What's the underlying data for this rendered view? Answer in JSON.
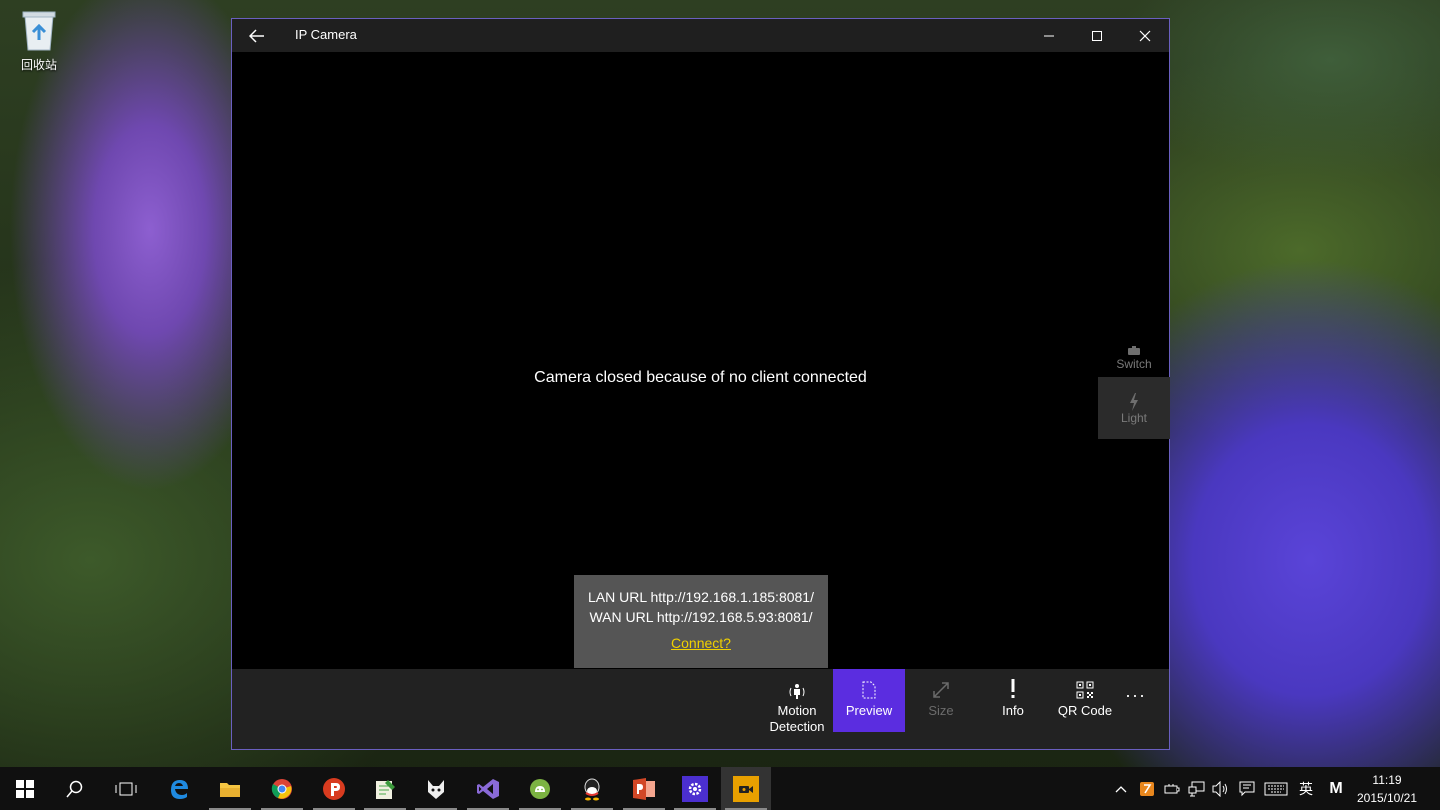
{
  "desktop": {
    "recycle_bin_label": "回收站"
  },
  "window": {
    "title": "IP Camera",
    "status_message": "Camera closed because of no client connected",
    "side_buttons": {
      "switch_label": "Switch",
      "light_label": "Light"
    },
    "url_popup": {
      "lan_url": "LAN URL http://192.168.1.185:8081/",
      "wan_url": "WAN URL http://192.168.5.93:8081/",
      "connect_link": "Connect?"
    },
    "app_bar": {
      "motion_detection_label_1": "Motion",
      "motion_detection_label_2": "Detection",
      "preview_label": "Preview",
      "size_label": "Size",
      "info_label": "Info",
      "qr_code_label": "QR Code",
      "more_label": "···"
    },
    "accent_color": "#5b2de0"
  },
  "taskbar": {
    "pinned_icons": [
      "start-icon",
      "search-icon",
      "task-view-icon",
      "edge-icon",
      "file-explorer-icon",
      "chrome-icon",
      "p-app-icon",
      "notepad-app-icon",
      "foobar-icon",
      "visual-studio-icon",
      "android-studio-icon",
      "qq-icon",
      "powerpoint-icon",
      "settings-icon",
      "ip-camera-icon"
    ],
    "tray": {
      "ime_label": "英",
      "m_label": "M",
      "time": "11:19",
      "date": "2015/10/21"
    }
  }
}
